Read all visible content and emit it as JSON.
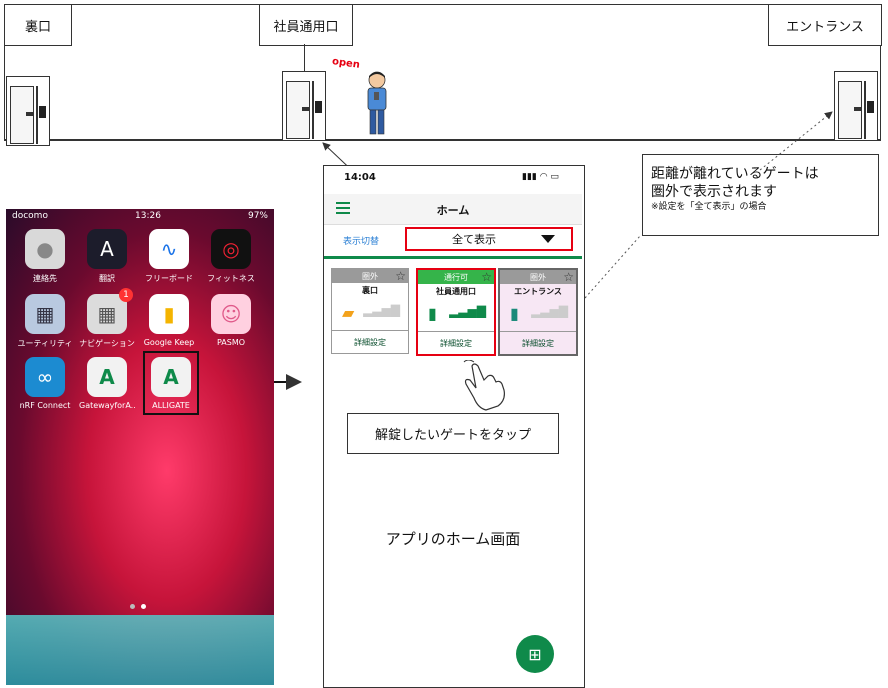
{
  "gates": {
    "left": "裏口",
    "middle": "社員通用口",
    "right": "エントランス",
    "open_text": "open"
  },
  "callout": {
    "line1": "距離が離れているゲートは",
    "line2": "圏外で表示されます",
    "note": "※設定を「全て表示」の場合"
  },
  "ios": {
    "carrier": "docomo",
    "time": "13:26",
    "battery": "97%",
    "apps": [
      {
        "label": "連絡先",
        "icon": "contacts-icon",
        "color": "#d9d9d9"
      },
      {
        "label": "翻訳",
        "icon": "translate-icon",
        "color": "#1c1c2b"
      },
      {
        "label": "フリーボード",
        "icon": "freeform-icon",
        "color": "#ffffff"
      },
      {
        "label": "フィットネス",
        "icon": "fitness-icon",
        "color": "#111111"
      },
      {
        "label": "ユーティリティ",
        "icon": "folder-icon",
        "color": "#b9c9e0"
      },
      {
        "label": "ナビゲーション",
        "icon": "folder-icon",
        "color": "#dcdcdc"
      },
      {
        "label": "Google Keep",
        "icon": "keep-icon",
        "color": "#ffffff"
      },
      {
        "label": "PASMO",
        "icon": "pasmo-icon",
        "color": "#ffd0e0"
      },
      {
        "label": "nRF Connect",
        "icon": "nrf-icon",
        "color": "#1c8bd1"
      },
      {
        "label": "GatewayforA...",
        "icon": "alligate-icon",
        "color": "#f2f2f2"
      },
      {
        "label": "ALLIGATE",
        "icon": "alligate-icon",
        "color": "#f2f2f2"
      }
    ],
    "nav_badge": "1"
  },
  "app": {
    "time": "14:04",
    "title": "ホーム",
    "filter_label": "表示切替",
    "filter_value": "全て表示",
    "cards": [
      {
        "status": "圏外",
        "name": "裏口",
        "button": "詳細設定",
        "header_color": "#9a9a9a"
      },
      {
        "status": "通行可",
        "name": "社員通用口",
        "button": "詳細設定",
        "header_color": "#35b44a"
      },
      {
        "status": "圏外",
        "name": "エントランス",
        "button": "詳細設定",
        "header_color": "#9a9a9a"
      }
    ],
    "tap_instruction": "解錠したいゲートをタップ",
    "screen_caption": "アプリのホーム画面"
  },
  "colors": {
    "accent_green": "#0f8a4a",
    "highlight_red": "#e60012",
    "open_red": "#e60012"
  }
}
